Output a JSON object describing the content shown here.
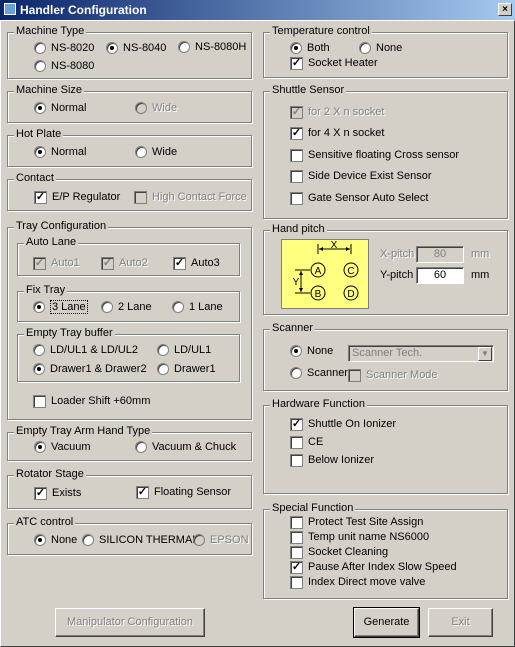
{
  "window": {
    "title": "Handler Configuration",
    "close": "×"
  },
  "machine_type": {
    "title": "Machine Type",
    "opt1": "NS-8020",
    "opt2": "NS-8040",
    "opt3": "NS-8080H",
    "opt4": "NS-8080"
  },
  "machine_size": {
    "title": "Machine Size",
    "normal": "Normal",
    "wide": "Wide"
  },
  "hot_plate": {
    "title": "Hot Plate",
    "normal": "Normal",
    "wide": "Wide"
  },
  "contact": {
    "title": "Contact",
    "ep": "E/P Regulator",
    "high": "High Contact Force"
  },
  "tray_config": {
    "title": "Tray Configuration",
    "auto_lane": {
      "title": "Auto Lane",
      "a1": "Auto1",
      "a2": "Auto2",
      "a3": "Auto3"
    },
    "fix_tray": {
      "title": "Fix Tray",
      "l3": "3 Lane",
      "l2": "2 Lane",
      "l1": "1 Lane"
    },
    "empty_buffer": {
      "title": "Empty Tray buffer",
      "o1": "LD/UL1 & LD/UL2",
      "o2": "LD/UL1",
      "o3": "Drawer1 & Drawer2",
      "o4": "Drawer1"
    },
    "loader_shift": "Loader Shift +60mm"
  },
  "arm_hand": {
    "title": "Empty Tray Arm Hand Type",
    "vacuum": "Vacuum",
    "chuck": "Vacuum & Chuck"
  },
  "rotator": {
    "title": "Rotator Stage",
    "exists": "Exists",
    "floating": "Floating Sensor"
  },
  "atc": {
    "title": "ATC control",
    "none": "None",
    "silicon": "SILICON THERMAL",
    "epson": "EPSON"
  },
  "temperature": {
    "title": "Temperature control",
    "both": "Both",
    "none": "None",
    "heater": "Socket Heater"
  },
  "shuttle": {
    "title": "Shuttle Sensor",
    "s1": "for 2 X n socket",
    "s2": "for 4 X n socket",
    "s3": "Sensitive floating Cross sensor",
    "s4": "Side Device Exist Sensor",
    "s5": "Gate Sensor Auto Select"
  },
  "hand_pitch": {
    "title": "Hand pitch",
    "xpitch_label": "X-pitch",
    "xpitch": "80",
    "ypitch_label": "Y-pitch",
    "ypitch": "60",
    "unit": "mm",
    "x": "X",
    "y": "Y",
    "a": "A",
    "b": "B",
    "c": "C",
    "d": "D"
  },
  "scanner": {
    "title": "Scanner",
    "none": "None",
    "scanner": "Scanner",
    "combo": "Scanner Tech.",
    "mode": "Scanner Mode"
  },
  "hardware": {
    "title": "Hardware Function",
    "h1": "Shuttle On Ionizer",
    "h2": "CE",
    "h3": "Below Ionizer"
  },
  "special": {
    "title": "Special Function",
    "f1": "Protect Test Site Assign",
    "f2": "Temp unit name NS6000",
    "f3": "Socket Cleaning",
    "f4": "Pause After Index Slow Speed",
    "f5": "Index Direct move valve"
  },
  "buttons": {
    "manipulator": "Manipulator Configuration",
    "generate": "Generate",
    "exit": "Exit"
  },
  "check_mark": "✓"
}
